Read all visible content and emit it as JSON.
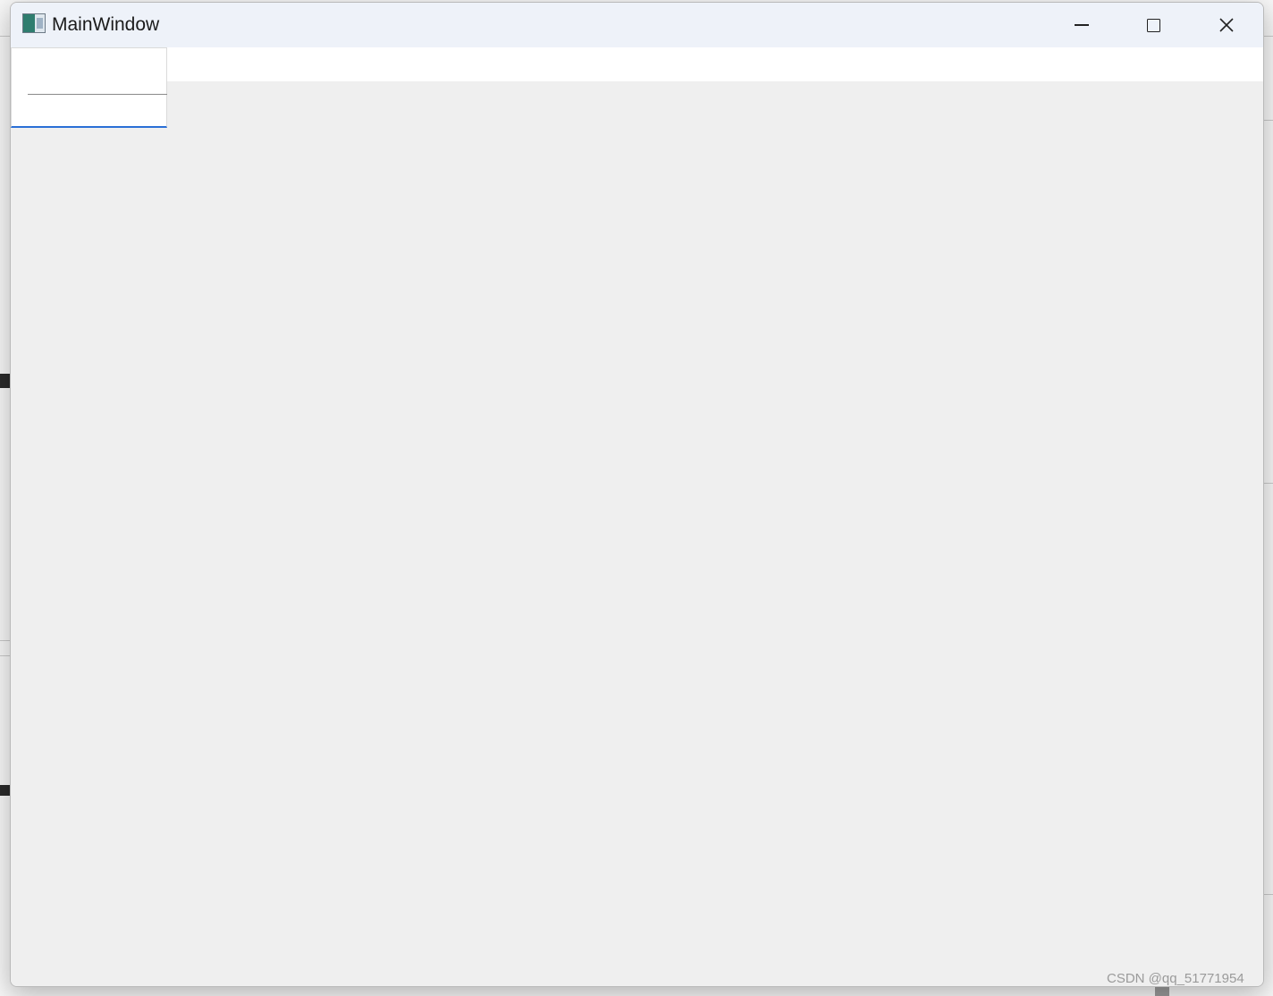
{
  "window": {
    "title": "MainWindow",
    "icon": "app-window-icon",
    "controls": {
      "minimize_icon": "minimize-icon",
      "maximize_icon": "maximize-icon",
      "close_icon": "close-icon",
      "close_glyph": "✕"
    }
  },
  "menu": {
    "popup_visible": true,
    "focus_color": "#2a6fd6"
  },
  "watermark": {
    "text": "CSDN @qq_51771954"
  },
  "colors": {
    "titlebar": "#eef2f9",
    "client_area": "#efefef",
    "menubar": "#ffffff"
  }
}
